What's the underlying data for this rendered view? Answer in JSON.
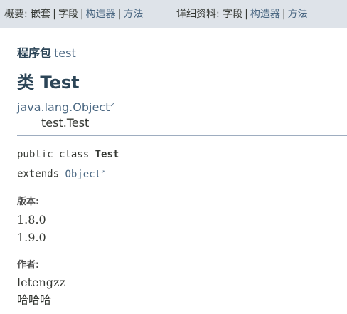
{
  "subnav": {
    "summary_label": "概要:",
    "summary_items": [
      "嵌套",
      "字段",
      "构造器",
      "方法"
    ],
    "detail_label": "详细资料:",
    "detail_items": [
      "字段",
      "构造器",
      "方法"
    ],
    "separator": "|"
  },
  "header": {
    "package_label": "程序包",
    "package_name": "test",
    "title": "类 Test"
  },
  "inheritance": {
    "parent": "java.lang.Object",
    "child": "test.Test"
  },
  "signature": {
    "line1_prefix": "public class",
    "line1_class": "Test",
    "line2_prefix": "extends",
    "line2_parent": "Object"
  },
  "version": {
    "label": "版本:",
    "values": [
      "1.8.0",
      "1.9.0"
    ]
  },
  "author": {
    "label": "作者:",
    "values": [
      "letengzz",
      "哈哈哈"
    ]
  },
  "icons": {
    "external_link": "external-link-icon"
  },
  "colors": {
    "subnav_bg": "#dee3e9",
    "link": "#4a6782",
    "title": "#2c4557",
    "divider": "#9eadc0"
  }
}
